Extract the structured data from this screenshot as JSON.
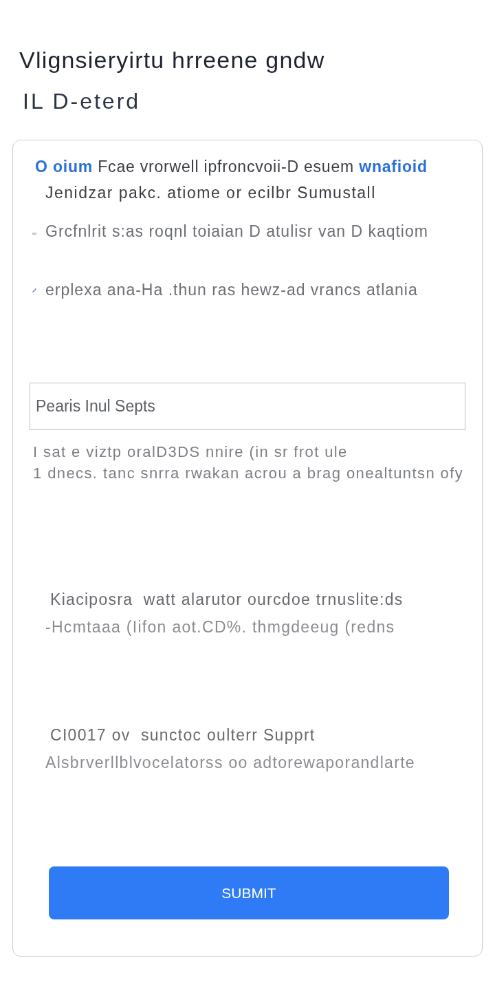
{
  "title": "Vlignsieryirtu hrreene gndw",
  "subtitle": "IL D-eterd",
  "card": {
    "intro": {
      "line_1": [
        {
          "kind": "link",
          "text": "O oium"
        },
        {
          "kind": "plain",
          "text": "Fcae vrorwell ipfroncvoii-D esuem"
        },
        {
          "kind": "link",
          "text": "wnafioid"
        }
      ],
      "line_2": "Jenidzar pakc. atiome or ecilbr Sumustall"
    },
    "notes": [
      {
        "kind": "dash",
        "text": "Grcfnlrit s:as roqnl toiaian D atulisr van D kaqtiom"
      },
      {
        "kind": "slash",
        "text": "erplexa ana-Ha .thun ras hewz-ad vrancs atlania"
      }
    ],
    "input": {
      "placeholder": "Pearis Inul Septs"
    },
    "helper_text": [
      "I sat e viztp oralD3DS nnire (in sr frot ule",
      "1 dnecs. tanc snrra rwakan acrou a brag onealtuntsn ofy"
    ],
    "sections": [
      {
        "heading": "Kiaciposra  watt alarutor ourcdoe trnuslite:ds",
        "body": "-Hcmtaaa (Iifon aot.CD%. thmgdeeug (redns"
      },
      {
        "heading": "CI0017 ov  sunctoc oulterr Supprt",
        "body": "Alsbrverllblvocelatorss oo adtorewaporandlarte"
      }
    ],
    "submit_button": "SUBMIT"
  }
}
